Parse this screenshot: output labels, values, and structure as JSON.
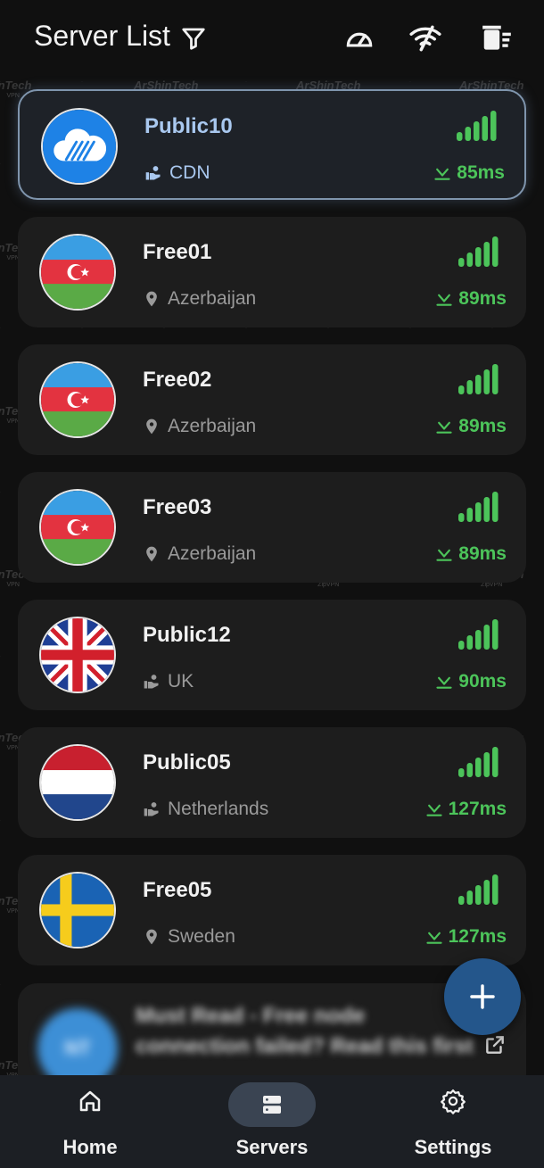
{
  "header": {
    "title": "Server List"
  },
  "watermark": {
    "text": "ArShinTech",
    "sub": "ZipVPN",
    "partial": "inTech",
    "partial_sub": "VPN"
  },
  "servers": [
    {
      "name": "Public10",
      "location": "CDN",
      "ping": "85ms",
      "flag": "cloud",
      "loc_icon": "cdn-icon",
      "selected": true
    },
    {
      "name": "Free01",
      "location": "Azerbaijan",
      "ping": "89ms",
      "flag": "azerbaijan",
      "loc_icon": "location-pin-icon"
    },
    {
      "name": "Free02",
      "location": "Azerbaijan",
      "ping": "89ms",
      "flag": "azerbaijan",
      "loc_icon": "location-pin-icon"
    },
    {
      "name": "Free03",
      "location": "Azerbaijan",
      "ping": "89ms",
      "flag": "azerbaijan",
      "loc_icon": "location-pin-icon"
    },
    {
      "name": "Public12",
      "location": "UK",
      "ping": "90ms",
      "flag": "uk",
      "loc_icon": "cdn-icon"
    },
    {
      "name": "Public05",
      "location": "Netherlands",
      "ping": "127ms",
      "flag": "netherlands",
      "loc_icon": "cdn-icon"
    },
    {
      "name": "Free05",
      "location": "Sweden",
      "ping": "127ms",
      "flag": "sweden",
      "loc_icon": "location-pin-icon"
    }
  ],
  "notice": {
    "avatar": "NT",
    "text": "Must Read - Free node connection failed? Read this first"
  },
  "nav": [
    {
      "label": "Home",
      "icon": "home-icon"
    },
    {
      "label": "Servers",
      "icon": "servers-icon",
      "active": true
    },
    {
      "label": "Settings",
      "icon": "gear-icon"
    }
  ],
  "colors": {
    "background": "#101010",
    "card": "#1d1d1d",
    "selected_border": "#7f95ad",
    "selected_text": "#a9c8ef",
    "ping_green": "#4cc45a",
    "fab": "#24568b",
    "nav_bg": "#1c1f24",
    "nav_pill": "#3a4452"
  }
}
